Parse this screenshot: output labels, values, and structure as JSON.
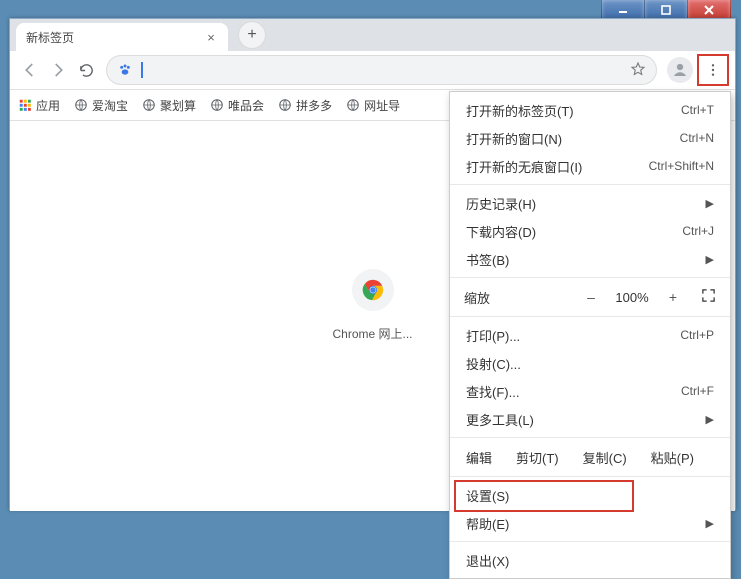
{
  "window": {
    "tab_title": "新标签页"
  },
  "omnibox": {
    "value": "",
    "placeholder": ""
  },
  "bookmarks": {
    "apps": "应用",
    "items": [
      "爱淘宝",
      "聚划算",
      "唯品会",
      "拼多多",
      "网址导"
    ]
  },
  "content": {
    "tile_label": "Chrome 网上..."
  },
  "menu": {
    "new_tab": "打开新的标签页(T)",
    "new_tab_sc": "Ctrl+T",
    "new_window": "打开新的窗口(N)",
    "new_window_sc": "Ctrl+N",
    "incognito": "打开新的无痕窗口(I)",
    "incognito_sc": "Ctrl+Shift+N",
    "history": "历史记录(H)",
    "downloads": "下载内容(D)",
    "downloads_sc": "Ctrl+J",
    "bookmarks": "书签(B)",
    "zoom_label": "缩放",
    "zoom_minus": "–",
    "zoom_value": "100%",
    "zoom_plus": "+",
    "print": "打印(P)...",
    "print_sc": "Ctrl+P",
    "cast": "投射(C)...",
    "find": "查找(F)...",
    "find_sc": "Ctrl+F",
    "more_tools": "更多工具(L)",
    "edit": "编辑",
    "cut": "剪切(T)",
    "copy": "复制(C)",
    "paste": "粘贴(P)",
    "settings": "设置(S)",
    "help": "帮助(E)",
    "exit": "退出(X)"
  }
}
